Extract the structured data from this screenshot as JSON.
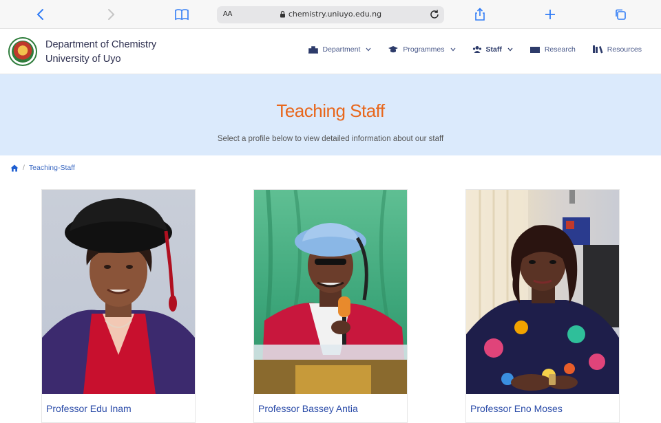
{
  "browser": {
    "text_size_label": "AA",
    "url": "chemistry.uniuyo.edu.ng"
  },
  "header": {
    "brand_line1": "Department of Chemistry",
    "brand_line2": "University of Uyo",
    "nav": [
      {
        "label": "Department",
        "icon": "building-icon",
        "dropdown": true
      },
      {
        "label": "Programmes",
        "icon": "graduation-cap-icon",
        "dropdown": true
      },
      {
        "label": "Staff",
        "icon": "users-icon",
        "dropdown": true,
        "active": true
      },
      {
        "label": "Research",
        "icon": "book-open-icon",
        "dropdown": false
      },
      {
        "label": "Resources",
        "icon": "books-icon",
        "dropdown": false
      }
    ]
  },
  "hero": {
    "title": "Teaching Staff",
    "subtitle": "Select a profile below to view detailed information about our staff"
  },
  "breadcrumb": {
    "current": "Teaching-Staff"
  },
  "staff": [
    {
      "name": "Professor Edu Inam"
    },
    {
      "name": "Professor Bassey Antia"
    },
    {
      "name": "Professor Eno Moses"
    }
  ],
  "colors": {
    "accent_orange": "#e8671c",
    "hero_bg": "#dbeafc",
    "link_blue": "#2a4ba8",
    "brand_navy": "#2d2f4f"
  }
}
